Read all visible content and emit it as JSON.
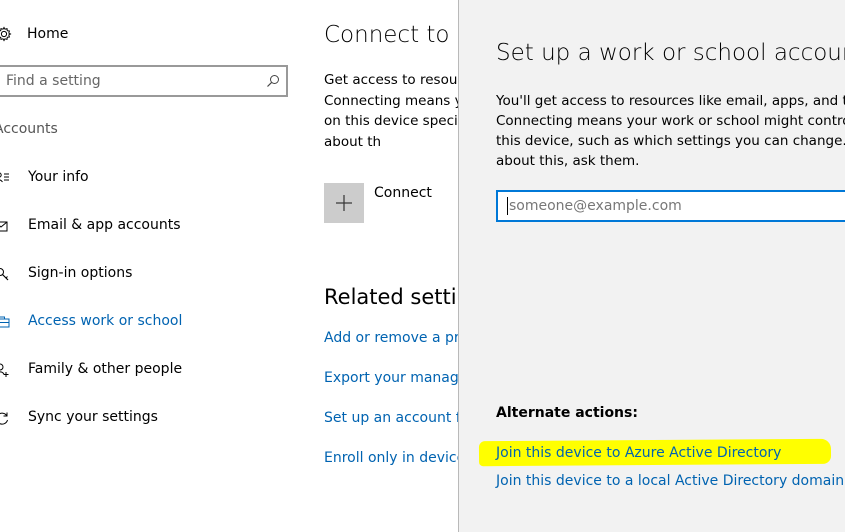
{
  "sidebar": {
    "home_label": "Home",
    "search_placeholder": "Find a setting",
    "section_header": "Accounts",
    "items": [
      {
        "label": "Your info",
        "icon": "contact-card-icon"
      },
      {
        "label": "Email & app accounts",
        "icon": "mail-icon"
      },
      {
        "label": "Sign-in options",
        "icon": "key-icon"
      },
      {
        "label": "Access work or school",
        "icon": "briefcase-icon",
        "active": true
      },
      {
        "label": "Family & other people",
        "icon": "person-add-icon"
      },
      {
        "label": "Sync your settings",
        "icon": "sync-icon"
      }
    ]
  },
  "main": {
    "title": "Connect to w",
    "description": "Get access to resour Connecting means y things on this device specific info about th",
    "connect_label": "Connect",
    "related_title": "Related settin",
    "related_links": [
      "Add or remove a pro",
      "Export your manage",
      "Set up an account fo",
      "Enroll only in device"
    ]
  },
  "dialog": {
    "title": "Set up a work or school account",
    "description": "You'll get access to resources like email, apps, and the network. Connecting means your work or school might control some things on this device, such as which settings you can change. For specific info about this, ask them.",
    "email_placeholder": "someone@example.com",
    "alternate_header": "Alternate actions:",
    "alternate_links": [
      "Join this device to Azure Active Directory",
      "Join this device to a local Active Directory domain"
    ],
    "highlight_color": "#ffff00"
  },
  "colors": {
    "accent": "#0063b1",
    "focus_border": "#0078d7",
    "dialog_bg": "#f2f2f2"
  }
}
